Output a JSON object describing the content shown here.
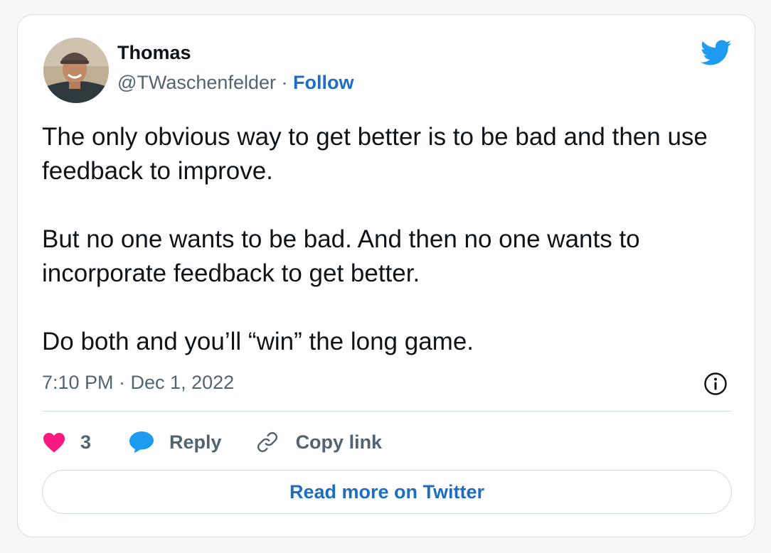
{
  "author": {
    "name": "Thomas",
    "handle": "@TWaschenfelder",
    "separator": "·",
    "follow_label": "Follow",
    "avatar_icon": "profile-photo"
  },
  "tweet": {
    "paragraphs": [
      "The only obvious way to get better is to be bad and then use feedback to improve.",
      "But no one wants to be bad. And then no one wants to incorporate feedback to get better.",
      "Do both and you’ll “win” the long game."
    ],
    "timestamp": "7:10 PM · Dec 1, 2022"
  },
  "actions": {
    "like_count": "3",
    "reply_label": "Reply",
    "copy_link_label": "Copy link"
  },
  "read_more_label": "Read more on Twitter",
  "colors": {
    "accent": "#1d6ec2",
    "twitter_blue": "#1d9bf0",
    "like_pink": "#f91880",
    "muted_text": "#536471",
    "body_text": "#0f1419"
  },
  "icons": {
    "brand": "twitter-bird-icon",
    "info": "info-icon",
    "like": "heart-icon",
    "reply": "speech-bubble-icon",
    "copy": "link-icon"
  }
}
